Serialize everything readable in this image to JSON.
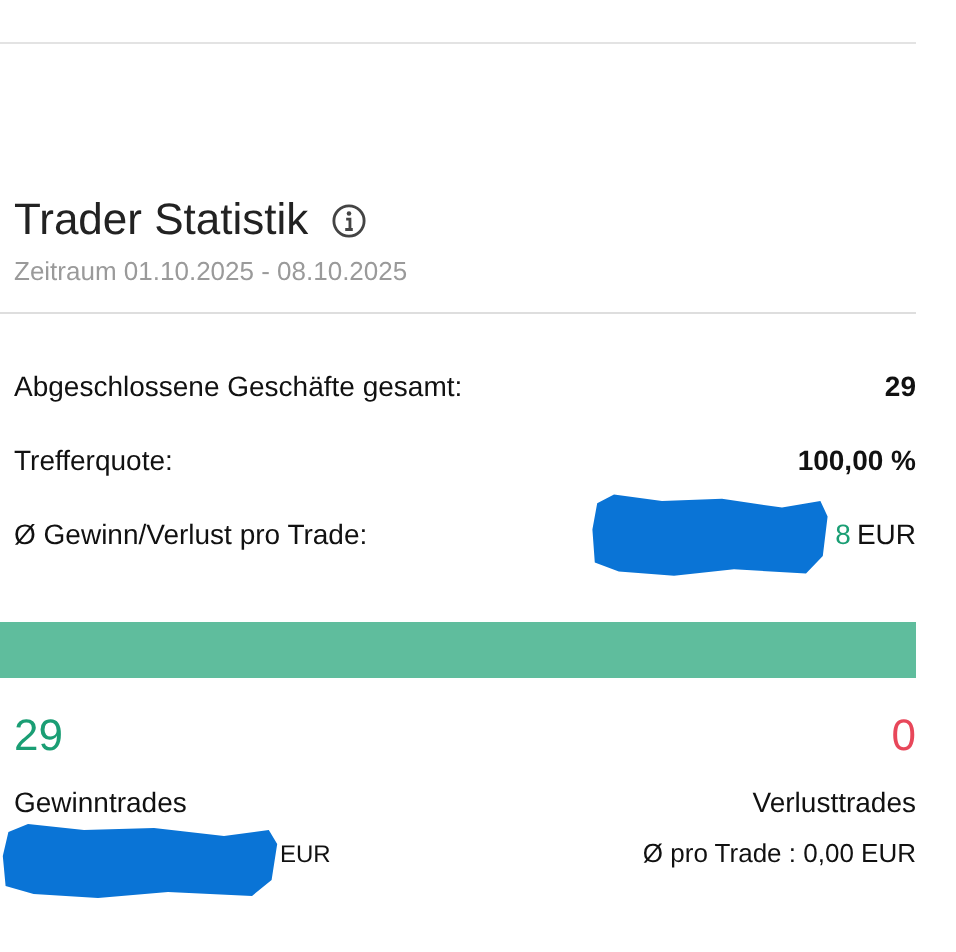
{
  "title": "Trader Statistik",
  "period": {
    "label": "Zeitraum",
    "range": "01.10.2025 - 08.10.2025"
  },
  "stats": [
    {
      "label": "Abgeschlossene Geschäfte gesamt:",
      "value": "29",
      "kind": "plain"
    },
    {
      "label": "Trefferquote:",
      "value": "100,00 %",
      "kind": "plain"
    },
    {
      "label": "Ø Gewinn/Verlust pro Trade:",
      "value": "8",
      "unit": "EUR",
      "kind": "redacted"
    }
  ],
  "ratio_bar": {
    "level": 1
  },
  "wins": {
    "count": "29",
    "label": "Gewinntrades",
    "unit": "EUR"
  },
  "losses": {
    "count": "0",
    "label": "Verlusttrades",
    "avg_label": "Ø pro Trade :",
    "avg_value": "0,00 EUR"
  }
}
